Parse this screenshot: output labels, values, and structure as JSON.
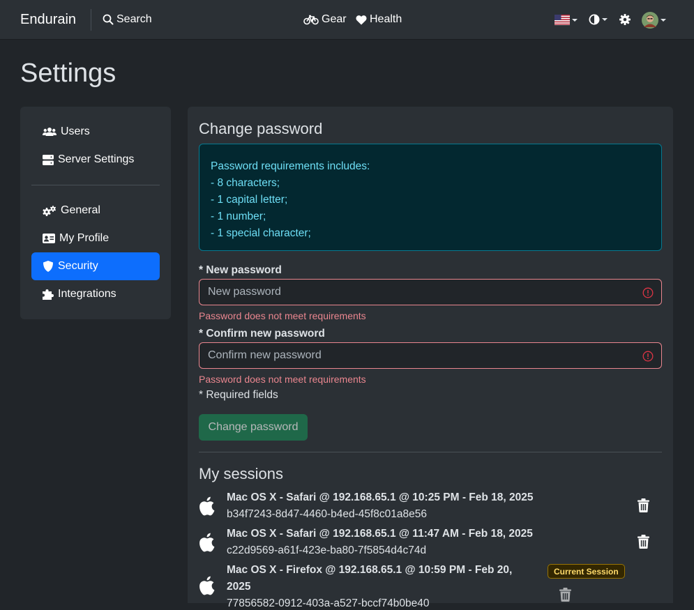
{
  "navbar": {
    "brand": "Endurain",
    "search_label": "Search",
    "gear_label": "Gear",
    "health_label": "Health",
    "language_flag": "us-flag-icon",
    "theme_icon": "half-circle-icon",
    "settings_icon": "gear-icon",
    "avatar_icon": "user-avatar"
  },
  "page": {
    "title": "Settings"
  },
  "sidebar": {
    "items": [
      {
        "label": "Users",
        "icon": "users-icon",
        "active": false
      },
      {
        "label": "Server Settings",
        "icon": "server-icon",
        "active": false
      },
      {
        "label": "General",
        "icon": "gears-icon",
        "active": false
      },
      {
        "label": "My Profile",
        "icon": "id-card-icon",
        "active": false
      },
      {
        "label": "Security",
        "icon": "shield-icon",
        "active": true
      },
      {
        "label": "Integrations",
        "icon": "puzzle-icon",
        "active": false
      }
    ]
  },
  "change_password": {
    "title": "Change password",
    "requirements": [
      "Password requirements includes:",
      "- 8 characters;",
      "- 1 capital letter;",
      "- 1 number;",
      "- 1 special character;"
    ],
    "new_password_label": "* New password",
    "new_password_placeholder": "New password",
    "new_password_value": "",
    "new_password_error": "Password does not meet requirements",
    "confirm_password_label": "* Confirm new password",
    "confirm_password_placeholder": "Confirm new password",
    "confirm_password_value": "",
    "confirm_password_error": "Password does not meet requirements",
    "required_note": "* Required fields",
    "submit_label": "Change password"
  },
  "sessions": {
    "title": "My sessions",
    "items": [
      {
        "title": "Mac OS X - Safari @ 192.168.65.1 @ 10:25 PM - Feb 18, 2025",
        "id": "b34f7243-8d47-4460-b4ed-45f8c01a8e56",
        "current": false
      },
      {
        "title": "Mac OS X - Safari @ 192.168.65.1 @ 11:47 AM - Feb 18, 2025",
        "id": "c22d9569-a61f-423e-ba80-7f5854d4c74d",
        "current": false
      },
      {
        "title_line1": "Mac OS X - Firefox @ 192.168.65.1 @ 10:59 PM - Feb 20,",
        "title_line2": "2025",
        "id": "77856582-0912-403a-a527-bccf74b0be40",
        "current": true,
        "badge": "Current Session"
      }
    ]
  },
  "colors": {
    "background": "#212529",
    "surface": "#2b3035",
    "primary": "#0d6efd",
    "success": "#198754",
    "info_text": "#6edff6",
    "danger_text": "#ea868f",
    "warning_text": "#ffda6a"
  }
}
